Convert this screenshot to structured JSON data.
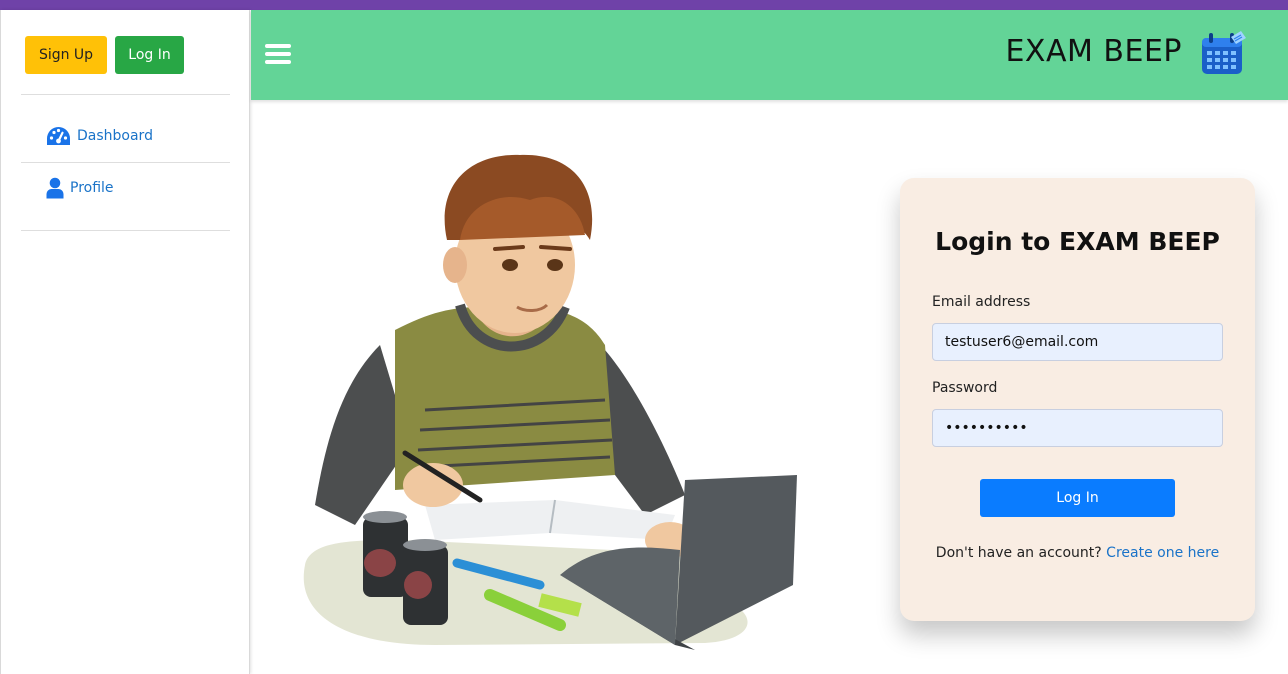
{
  "sidebar": {
    "signup_label": "Sign Up",
    "login_label": "Log In",
    "items": [
      {
        "label": "Dashboard",
        "icon": "dashboard-gauge-icon"
      },
      {
        "label": "Profile",
        "icon": "user-icon"
      }
    ]
  },
  "header": {
    "menu_icon": "hamburger-menu-icon",
    "brand": "EXAM BEEP",
    "brand_icon": "calendar-icon"
  },
  "illustration": {
    "description": "student-studying-illustration"
  },
  "login_card": {
    "title": "Login to EXAM BEEP",
    "email_label": "Email address",
    "email_value": "testuser6@email.com",
    "password_label": "Password",
    "password_value": "••••••••••",
    "submit_label": "Log In",
    "no_account_text": "Don't have an account?",
    "create_link": "Create one here"
  },
  "colors": {
    "top_strip": "#6f42a8",
    "header": "#63d497",
    "signup_btn": "#ffc107",
    "login_btn_sidebar": "#28a745",
    "login_btn_main": "#0a7cff",
    "link": "#1a73c8",
    "card_bg": "#f9ede3"
  }
}
